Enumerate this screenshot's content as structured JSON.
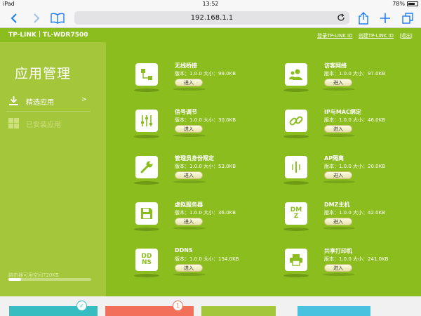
{
  "status_bar": {
    "device": "iPad",
    "time": "13:52",
    "battery": "78%",
    "battery_level": 0.78
  },
  "browser": {
    "url": "192.168.1.1"
  },
  "header": {
    "brand": "TP-LINK",
    "model": "TL-WDR7500",
    "links": [
      "登录TP-LINK ID",
      "创建TP-LINK ID",
      "退出"
    ]
  },
  "sidebar": {
    "title": "应用管理",
    "items": [
      {
        "label": "精选应用",
        "arrow": ">"
      },
      {
        "label": "已安装应用"
      }
    ],
    "storage_text": "路由器可用空间720KB",
    "storage_used": 0.15
  },
  "apps": [
    {
      "name": "无线桥接",
      "meta": "版本：1.0.0 大小：99.0KB",
      "button": "进入",
      "icon": "bridge-icon"
    },
    {
      "name": "访客网络",
      "meta": "版本：1.0.0 大小：97.0KB",
      "button": "进入",
      "icon": "guest-users-icon"
    },
    {
      "name": "信号调节",
      "meta": "版本：1.0.0 大小：30.0KB",
      "button": "进入",
      "icon": "sliders-icon"
    },
    {
      "name": "IP与MAC绑定",
      "meta": "版本：1.0.0 大小：46.0KB",
      "button": "进入",
      "icon": "link-icon"
    },
    {
      "name": "管理员身份限定",
      "meta": "版本：1.0.0 大小：53.0KB",
      "button": "进入",
      "icon": "wrench-icon"
    },
    {
      "name": "AP隔离",
      "meta": "版本：1.0.0 大小：20.0KB",
      "button": "进入",
      "icon": "ap-isolation-icon"
    },
    {
      "name": "虚拟服务器",
      "meta": "版本：1.0.0 大小：36.0KB",
      "button": "进入",
      "icon": "floppy-icon"
    },
    {
      "name": "DMZ主机",
      "meta": "版本：1.0.0 大小：42.0KB",
      "button": "进入",
      "icon": "dmz-icon",
      "icon_text": "DMZ"
    },
    {
      "name": "DDNS",
      "meta": "版本：1.0.0 大小：134.0KB",
      "button": "进入",
      "icon": "ddns-icon",
      "icon_text": "DDNS"
    },
    {
      "name": "共享打印机",
      "meta": "版本：1.0.0 大小：241.0KB",
      "button": "进入",
      "icon": "printer-icon"
    }
  ],
  "bottom_tiles": [
    {
      "color": "#37bdc0",
      "badge": "✓"
    },
    {
      "color": "#f2705a",
      "badge": "1"
    },
    {
      "color": "#a3c63a"
    },
    {
      "color": "#49c2e0"
    }
  ],
  "colors": {
    "header_green": "#8bbd1e",
    "sidebar_green": "#a3c63a",
    "safari_blue": "#1e7cf5"
  }
}
